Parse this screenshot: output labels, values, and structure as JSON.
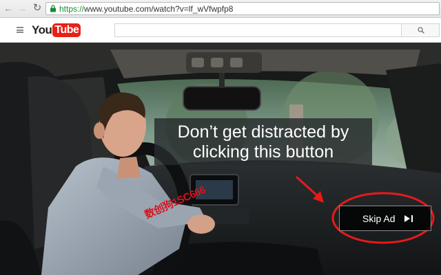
{
  "browser": {
    "back_icon": "back-arrow-icon",
    "forward_icon": "forward-arrow-icon",
    "reload_icon": "reload-icon",
    "lock_icon": "lock-icon",
    "url_scheme": "https://",
    "url_rest": "www.youtube.com/watch?v=lf_wVfwpfp8"
  },
  "header": {
    "menu_icon": "hamburger-menu-icon",
    "logo_you": "You",
    "logo_tube": "Tube",
    "search_placeholder": "",
    "search_value": "",
    "search_icon": "search-icon"
  },
  "video": {
    "caption": "Don’t get distracted by\nclicking this button",
    "skip_ad_label": "Skip Ad",
    "skip_icon": "skip-next-icon",
    "watermark": "数创狗1SC666"
  },
  "colors": {
    "brand_red": "#e62117",
    "annotation_red": "#e8191b",
    "url_green": "#1a8a34"
  }
}
